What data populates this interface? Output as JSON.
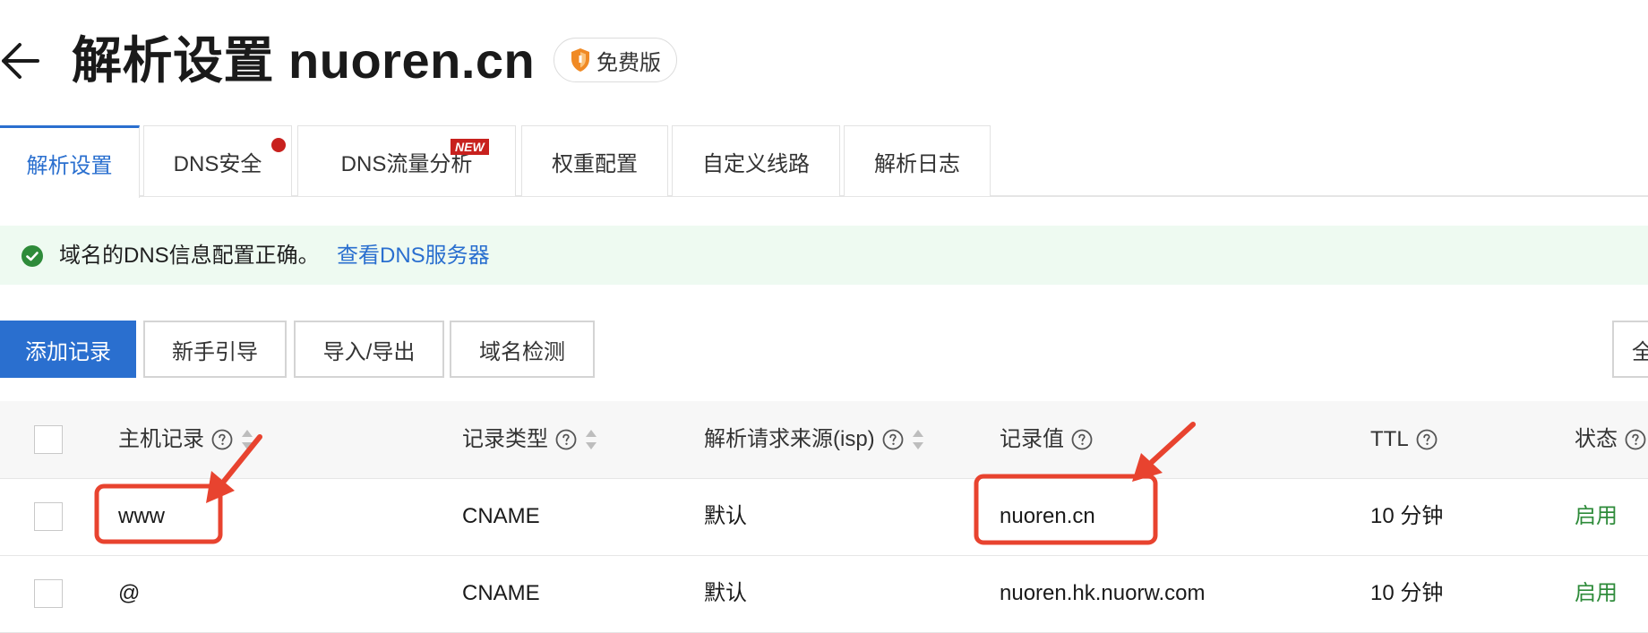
{
  "header": {
    "title": "解析设置 nuoren.cn",
    "badge": "免费版"
  },
  "tabs": [
    {
      "label": "解析设置"
    },
    {
      "label": "DNS安全"
    },
    {
      "label": "DNS流量分析",
      "badge": "NEW"
    },
    {
      "label": "权重配置"
    },
    {
      "label": "自定义线路"
    },
    {
      "label": "解析日志"
    }
  ],
  "notice": {
    "text": "域名的DNS信息配置正确。",
    "link": "查看DNS服务器"
  },
  "toolbar": {
    "add_record": "添加记录",
    "guide": "新手引导",
    "import_export": "导入/导出",
    "domain_check": "域名检测",
    "partial_button": "全"
  },
  "table": {
    "columns": [
      "主机记录",
      "记录类型",
      "解析请求来源(isp)",
      "记录值",
      "TTL",
      "状态"
    ],
    "rows": [
      {
        "host": "www",
        "type": "CNAME",
        "isp": "默认",
        "value": "nuoren.cn",
        "ttl": "10 分钟",
        "status": "启用"
      },
      {
        "host": "@",
        "type": "CNAME",
        "isp": "默认",
        "value": "nuoren.hk.nuorw.com",
        "ttl": "10 分钟",
        "status": "启用"
      }
    ]
  },
  "colors": {
    "accent": "#2a6fcf",
    "status_enabled": "#2e8b3a",
    "badge_red": "#c8211e",
    "annotation": "#e8432f"
  }
}
